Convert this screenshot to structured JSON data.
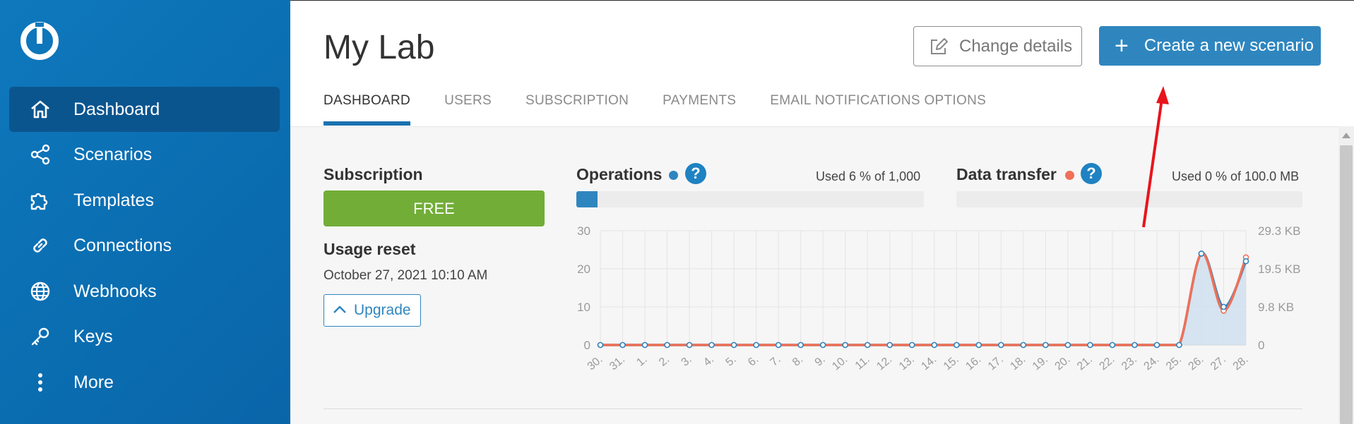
{
  "sidebar": {
    "items": [
      {
        "label": "Dashboard",
        "icon": "home-icon",
        "active": true
      },
      {
        "label": "Scenarios",
        "icon": "share-icon",
        "active": false
      },
      {
        "label": "Templates",
        "icon": "puzzle-icon",
        "active": false
      },
      {
        "label": "Connections",
        "icon": "link-icon",
        "active": false
      },
      {
        "label": "Webhooks",
        "icon": "globe-icon",
        "active": false
      },
      {
        "label": "Keys",
        "icon": "key-icon",
        "active": false
      },
      {
        "label": "More",
        "icon": "more-vertical-icon",
        "active": false
      }
    ]
  },
  "header": {
    "title": "My Lab",
    "change_details_label": "Change details",
    "create_scenario_label": "Create a new scenario"
  },
  "tabs": [
    "DASHBOARD",
    "USERS",
    "SUBSCRIPTION",
    "PAYMENTS",
    "EMAIL NOTIFICATIONS OPTIONS"
  ],
  "subscription": {
    "title": "Subscription",
    "plan": "FREE",
    "usage_reset_title": "Usage reset",
    "usage_reset_date": "October 27, 2021 10:10 AM",
    "upgrade_label": "Upgrade"
  },
  "operations": {
    "title": "Operations",
    "help": "?",
    "used_text": "Used 6 % of 1,000",
    "fraction": 0.06
  },
  "data_transfer": {
    "title": "Data transfer",
    "help": "?",
    "used_text": "Used 0 % of 100.0 MB",
    "fraction": 0.0
  },
  "colors": {
    "operations": "#2f86bf",
    "data_transfer": "#f07058",
    "free": "#72ad38",
    "sidebar": "#0a6db0"
  },
  "chart_data": {
    "type": "line",
    "title": "",
    "x": [
      "30.",
      "31.",
      "1.",
      "2.",
      "3.",
      "4.",
      "5.",
      "6.",
      "7.",
      "8.",
      "9.",
      "10.",
      "11.",
      "12.",
      "13.",
      "14.",
      "15.",
      "16.",
      "17.",
      "18.",
      "19.",
      "20.",
      "21.",
      "22.",
      "23.",
      "24.",
      "25.",
      "26.",
      "27.",
      "28."
    ],
    "y_left_ticks": [
      "0",
      "10",
      "20",
      "30"
    ],
    "y_left_range": [
      0,
      30
    ],
    "y_right_ticks": [
      "0",
      "9.8 KB",
      "19.5 KB",
      "29.3 KB"
    ],
    "series": [
      {
        "values": [
          0,
          0,
          0,
          0,
          0,
          0,
          0,
          0,
          0,
          0,
          0,
          0,
          0,
          0,
          0,
          0,
          0,
          0,
          0,
          0,
          0,
          0,
          0,
          0,
          0,
          0,
          0,
          24,
          10,
          22
        ],
        "color": "#2f86bf",
        "axis": "left"
      },
      {
        "values": [
          0,
          0,
          0,
          0,
          0,
          0,
          0,
          0,
          0,
          0,
          0,
          0,
          0,
          0,
          0,
          0,
          0,
          0,
          0,
          0,
          0,
          0,
          0,
          0,
          0,
          0,
          0,
          24,
          9,
          23
        ],
        "color": "#f07058",
        "axis": "right"
      }
    ],
    "grid": true
  }
}
